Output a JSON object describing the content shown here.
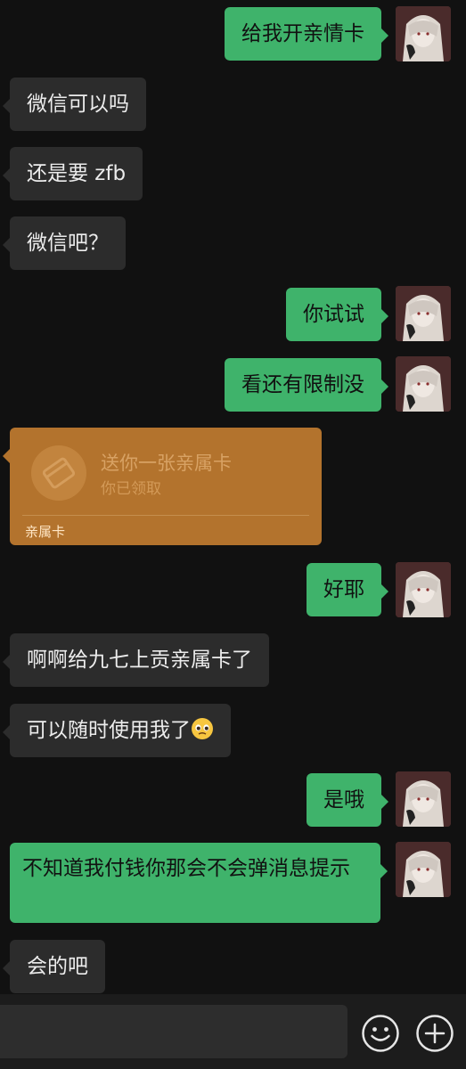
{
  "messages": [
    {
      "side": "out",
      "text": "给我开亲情卡"
    },
    {
      "side": "in",
      "text": "微信可以吗"
    },
    {
      "side": "in",
      "text": "还是要 zfb"
    },
    {
      "side": "in",
      "text": "微信吧？"
    },
    {
      "side": "out",
      "text": "你试试"
    },
    {
      "side": "out",
      "text": "看还有限制没"
    },
    {
      "side": "out",
      "text": "好耶"
    },
    {
      "side": "in",
      "text": "啊啊给九七上贡亲属卡了"
    },
    {
      "side": "in",
      "text": "可以随时使用我了"
    },
    {
      "side": "out",
      "text": "是哦"
    },
    {
      "side": "out",
      "text": "不知道我付钱你那会不会弹消息提示"
    },
    {
      "side": "in",
      "text": "会的吧"
    }
  ],
  "family_card": {
    "title": "送你一张亲属卡",
    "status": "你已领取",
    "footer": "亲属卡"
  },
  "emoji_after_msg9": "pleading-face",
  "colors": {
    "background": "#111111",
    "incoming_bubble": "#2c2c2c",
    "outgoing_bubble": "#3fb36b",
    "card": "#b3732d"
  },
  "input_bar": {
    "emoji_button_icon": "smiley-icon",
    "more_button_icon": "plus-circle-icon"
  }
}
